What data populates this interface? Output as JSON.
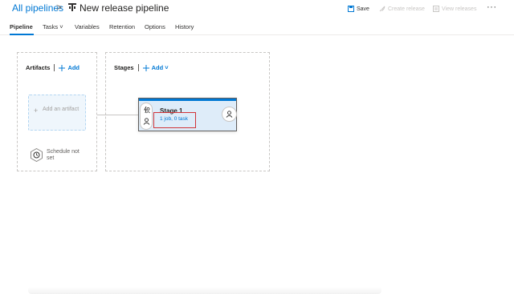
{
  "header": {
    "breadcrumb": "All pipelines",
    "separator": ">",
    "title": "New release pipeline",
    "actions": {
      "save": "Save",
      "create_release": "Create release",
      "view_releases": "View releases"
    },
    "more": "···"
  },
  "tabs": [
    {
      "label": "Pipeline",
      "active": true
    },
    {
      "label": "Tasks ˅",
      "active": false
    },
    {
      "label": "Variables",
      "active": false
    },
    {
      "label": "Retention",
      "active": false
    },
    {
      "label": "Options",
      "active": false
    },
    {
      "label": "History",
      "active": false
    }
  ],
  "artifacts": {
    "heading": "Artifacts",
    "add_label": "Add",
    "add_artifact": "Add an artifact",
    "add_artifact_plus": "+",
    "schedule": "Schedule not set"
  },
  "stages": {
    "heading": "Stages",
    "add_label": "Add ˅",
    "stage": {
      "name": "Stage 1",
      "tasks": "1 job, 0 task"
    }
  },
  "colors": {
    "accent": "#0078d4",
    "highlight_box": "#d13438",
    "stage_fill": "#deecf9"
  },
  "icons": [
    "pipeline-icon",
    "save-icon",
    "rocket-icon",
    "list-icon",
    "plus-icon",
    "clock-icon",
    "lightning-person-icon",
    "person-icon"
  ]
}
